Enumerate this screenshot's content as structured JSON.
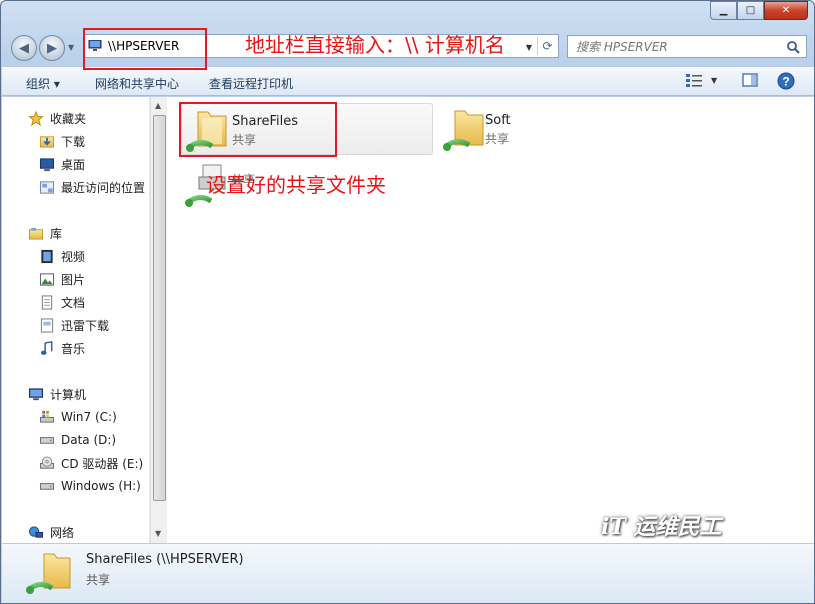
{
  "window": {
    "controls": [
      "minimize",
      "maximize",
      "close"
    ],
    "minimize_glyph": "▁",
    "maximize_glyph": "□",
    "close_glyph": "✕"
  },
  "address_bar": {
    "value": "\\\\HPSERVER"
  },
  "search": {
    "placeholder": "搜索 HPSERVER"
  },
  "toolbar": {
    "organize_label": "组织 ▾",
    "network_center_label": "网络和共享中心",
    "printers_label": "查看远程打印机"
  },
  "nav": {
    "favorites": {
      "label": "收藏夹",
      "items": [
        "下载",
        "桌面",
        "最近访问的位置"
      ]
    },
    "libraries": {
      "label": "库",
      "items": [
        "视频",
        "图片",
        "文档",
        "迅雷下载",
        "音乐"
      ]
    },
    "computer": {
      "label": "计算机",
      "items": [
        "Win7 (C:)",
        "Data (D:)",
        "CD 驱动器 (E:)",
        "Windows (H:)"
      ]
    },
    "network": {
      "label": "网络"
    }
  },
  "shares": [
    {
      "name": "ShareFiles",
      "type": "共享"
    },
    {
      "name": "Soft",
      "type": "共享"
    },
    {
      "name": "",
      "type": "共享"
    }
  ],
  "annotations": {
    "address_hint": "地址栏直接输入：\\\\ 计算机名",
    "shared_folder_hint": "设置好的共享文件夹"
  },
  "watermark": "iT 运维民工",
  "details": {
    "name": "ShareFiles (\\\\HPSERVER)",
    "type": "共享"
  },
  "colors": {
    "accent": "#1e395b",
    "annotation": "#e5191e"
  }
}
